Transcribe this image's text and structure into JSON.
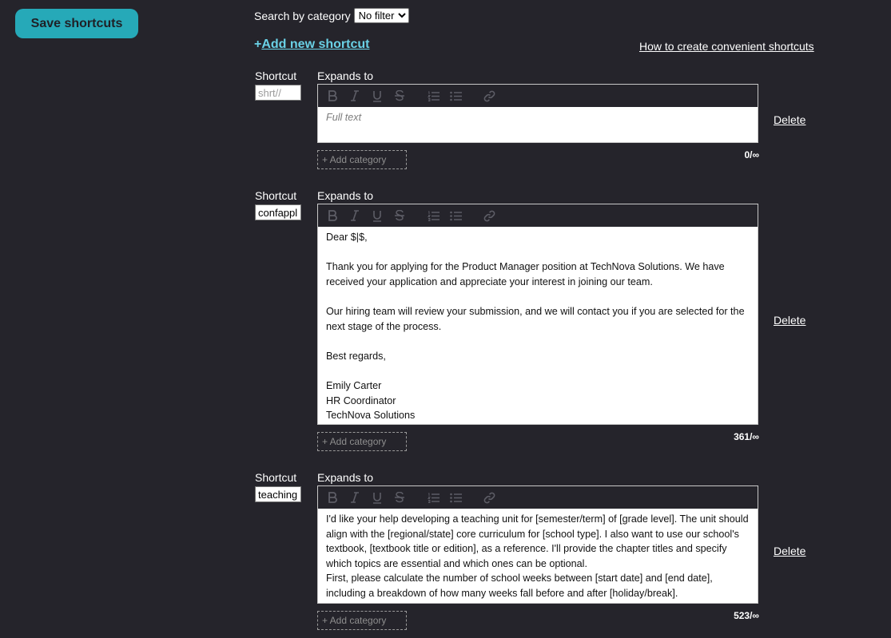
{
  "save_button": "Save shortcuts",
  "search": {
    "label": "Search by category",
    "selected": "No filter"
  },
  "add_new": {
    "plus": "+",
    "label": "Add new shortcut"
  },
  "howto_link": "How to create convenient shortcuts",
  "labels": {
    "shortcut": "Shortcut",
    "expands": "Expands to",
    "add_category": "+ Add category",
    "delete": "Delete"
  },
  "toolbar_icons": [
    "bold-icon",
    "italic-icon",
    "underline-icon",
    "strikethrough-icon",
    "ordered-list-icon",
    "bullet-list-icon",
    "link-icon"
  ],
  "entries": [
    {
      "shortcut_value": "",
      "shortcut_placeholder": "shrt//",
      "placeholder": "Full text",
      "paragraphs": [],
      "count": "0/∞"
    },
    {
      "shortcut_value": "confappl",
      "shortcut_placeholder": "shrt//",
      "placeholder": "",
      "paragraphs": [
        "Dear $|$,",
        "",
        "Thank you for applying for the Product Manager position at TechNova Solutions. We have received your application and appreciate your interest in joining our team.",
        "",
        "Our hiring team will review your submission, and we will contact you if you are selected for the next stage of the process.",
        "",
        "Best regards,",
        "",
        "Emily Carter",
        "HR Coordinator",
        "TechNova Solutions"
      ],
      "count": "361/∞"
    },
    {
      "shortcut_value": "teaching",
      "shortcut_placeholder": "shrt//",
      "placeholder": "",
      "paragraphs": [
        "I'd like your help developing a teaching unit for [semester/term] of [grade level]. The unit should align with the [regional/state] core curriculum for [school type]. I also want to use our school's textbook, [textbook title or edition], as a reference. I'll provide the chapter titles and specify which topics are essential and which ones can be optional.",
        "First, please calculate the number of school weeks between [start date] and [end date], including a breakdown of how many weeks fall before and after [holiday/break]."
      ],
      "count": "523/∞"
    }
  ]
}
